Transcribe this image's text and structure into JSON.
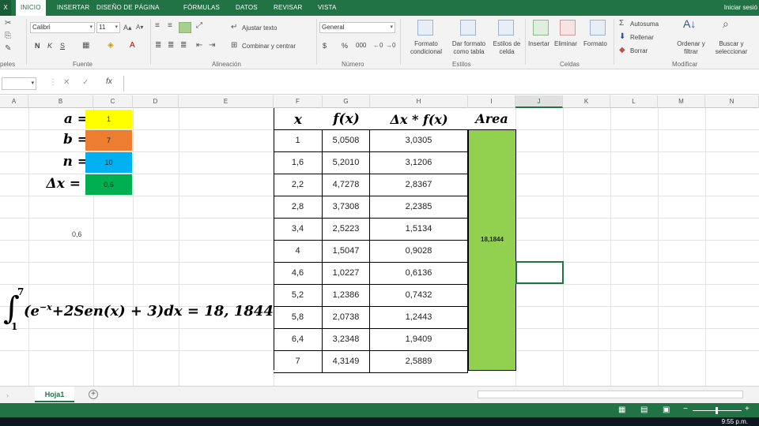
{
  "window": {
    "app_badge": "X",
    "tabs": [
      "INICIO",
      "INSERTAR",
      "DISEÑO DE PÁGINA",
      "FÓRMULAS",
      "DATOS",
      "REVISAR",
      "VISTA"
    ],
    "signin": "Iniciar sesió"
  },
  "ribbon": {
    "font_name": "Calibri",
    "font_size": "11",
    "bold": "N",
    "italic": "K",
    "underline": "S",
    "wrap_text": "Ajustar texto",
    "merge_center": "Combinar y centrar",
    "number_format": "General",
    "currency": "$",
    "percent": "%",
    "thousands": "000",
    "format_conditional": "Formato condicional",
    "format_table": "Dar formato como tabla",
    "cell_styles": "Estilos de celda",
    "insert": "Insertar",
    "delete": "Eliminar",
    "format": "Formato",
    "autosum": "Autosuma",
    "fill": "Rellenar",
    "clear": "Borrar",
    "sort_filter": "Ordenar y filtrar",
    "find_select": "Buscar y seleccionar",
    "groups": {
      "clipboard": "peles",
      "font": "Fuente",
      "alignment": "Alineación",
      "number": "Número",
      "styles": "Estilos",
      "cells": "Celdas",
      "editing": "Modificar"
    }
  },
  "formula_bar": {
    "fx": "fx",
    "value": ""
  },
  "columns": [
    "A",
    "B",
    "C",
    "D",
    "E",
    "F",
    "G",
    "H",
    "I",
    "J",
    "K",
    "L",
    "M",
    "N"
  ],
  "params": [
    {
      "label": "a =",
      "value": "1",
      "color": "#ffff00"
    },
    {
      "label": "b =",
      "value": "7",
      "color": "#ed7d31"
    },
    {
      "label": "n =",
      "value": "10",
      "color": "#00b0f0"
    },
    {
      "label": "Δx =",
      "value": "0,6",
      "color": "#00b050"
    }
  ],
  "loose_value": "0,6",
  "table": {
    "headers": [
      "x",
      "f(x)",
      "Δx * f(x)",
      "Area"
    ],
    "rows": [
      [
        "1",
        "5,0508",
        "3,0305"
      ],
      [
        "1,6",
        "5,2010",
        "3,1206"
      ],
      [
        "2,2",
        "4,7278",
        "2,8367"
      ],
      [
        "2,8",
        "3,7308",
        "2,2385"
      ],
      [
        "3,4",
        "2,5223",
        "1,5134"
      ],
      [
        "4",
        "1,5047",
        "0,9028"
      ],
      [
        "4,6",
        "1,0227",
        "0,6136"
      ],
      [
        "5,2",
        "1,2386",
        "0,7432"
      ],
      [
        "5,8",
        "2,0738",
        "1,2443"
      ],
      [
        "6,4",
        "3,2348",
        "1,9409"
      ],
      [
        "7",
        "4,3149",
        "2,5889"
      ]
    ],
    "area_value": "18,1844",
    "area_color": "#92d050"
  },
  "equation": {
    "upper": "7",
    "lower": "1",
    "body": "(e",
    "exp": "−x",
    "rest": "+2Sen(x) + 3)dx = 18, 1844"
  },
  "sheet": {
    "name": "Hoja1",
    "add": "+"
  },
  "status": {
    "time": "9:55 p.m."
  }
}
